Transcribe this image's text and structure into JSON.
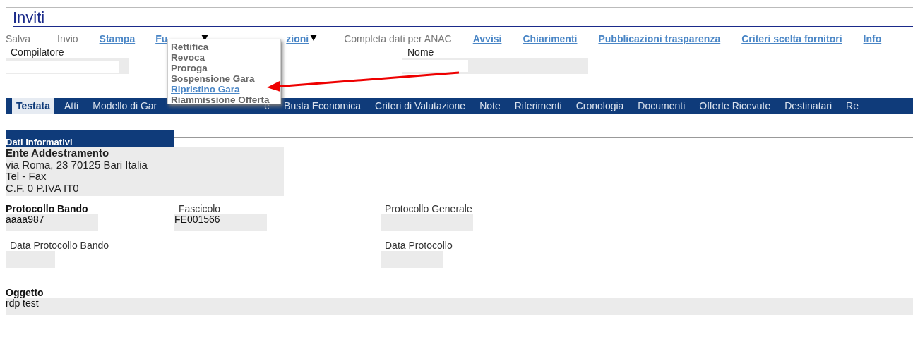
{
  "title": "Inviti",
  "toolbar": [
    {
      "label": "Salva",
      "kind": "plain"
    },
    {
      "label": "Invio",
      "kind": "plain"
    },
    {
      "label": "Stampa",
      "kind": "link"
    },
    {
      "label": "Fu",
      "kind": "dropdown"
    },
    {
      "label": "zioni",
      "kind": "dropdown"
    },
    {
      "label": "Completa dati per ANAC",
      "kind": "plain"
    },
    {
      "label": "Avvisi",
      "kind": "link"
    },
    {
      "label": "Chiarimenti",
      "kind": "link"
    },
    {
      "label": "Pubblicazioni trasparenza",
      "kind": "link"
    },
    {
      "label": "Criteri scelta fornitori",
      "kind": "link"
    },
    {
      "label": "Info",
      "kind": "link"
    }
  ],
  "menu": [
    {
      "label": "Rettifica",
      "selected": false
    },
    {
      "label": "Revoca",
      "selected": false
    },
    {
      "label": "Proroga",
      "selected": false
    },
    {
      "label": "Sospensione Gara",
      "selected": false
    },
    {
      "label": "Ripristino Gara",
      "selected": true
    },
    {
      "label": "Riammissione Offerta",
      "selected": false
    }
  ],
  "header_fields": [
    {
      "label": "Compilatore"
    },
    {
      "label": "Nome"
    }
  ],
  "tabs": [
    {
      "label": "Testata",
      "selected": true
    },
    {
      "label": "Atti",
      "selected": false
    },
    {
      "label": "Modello di Gar",
      "selected": false
    },
    {
      "label": "e",
      "selected": false
    },
    {
      "label": "Busta Economica",
      "selected": false
    },
    {
      "label": "Criteri di Valutazione",
      "selected": false
    },
    {
      "label": "Note",
      "selected": false
    },
    {
      "label": "Riferimenti",
      "selected": false
    },
    {
      "label": "Cronologia",
      "selected": false
    },
    {
      "label": "Documenti",
      "selected": false
    },
    {
      "label": "Offerte Ricevute",
      "selected": false
    },
    {
      "label": "Destinatari",
      "selected": false
    },
    {
      "label": "Re",
      "selected": false
    }
  ],
  "section": {
    "title": "Dati Informativi",
    "entity": {
      "name": "Ente Addestramento",
      "lines": [
        "via Roma, 23 70125 Bari Italia",
        "Tel - Fax",
        "C.F. 0 P.IVA IT0"
      ]
    }
  },
  "fields": [
    {
      "label": "Protocollo Bando",
      "value": "aaaa987",
      "bold": true
    },
    {
      "label": "Fascicolo",
      "value": "FE001566",
      "bold": false
    },
    {
      "label": "Protocollo Generale",
      "bold": false
    },
    {
      "label": "Data Protocollo Bando",
      "bold": false
    },
    {
      "label": "Data Protocollo",
      "bold": false
    },
    {
      "label": "Oggetto",
      "value": "rdp test",
      "bold": true
    }
  ]
}
